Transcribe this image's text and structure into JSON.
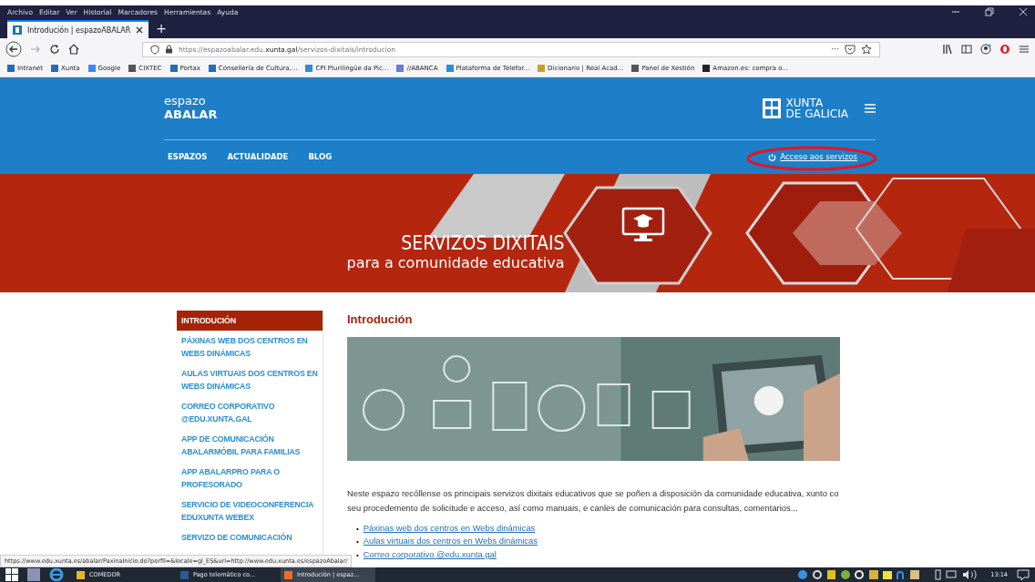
{
  "menu_bar": [
    "Archivo",
    "Editar",
    "Ver",
    "Historial",
    "Marcadores",
    "Herramientas",
    "Ayuda"
  ],
  "tabs": [
    {
      "label": "Introdución | espazoABALAR",
      "selected": true
    }
  ],
  "tab_new": "+",
  "address": {
    "url_start": "https://espazoabalar.edu.",
    "url_domain": "xunta.gal",
    "url_end": "/servizos-dixitais/introducion"
  },
  "address_more": "···",
  "bookmarks": [
    {
      "label": "Intranet",
      "kind": "xunta"
    },
    {
      "label": "Xunta",
      "kind": "xunta"
    },
    {
      "label": "Google",
      "kind": "google"
    },
    {
      "label": "CIXTEC",
      "kind": "globe"
    },
    {
      "label": "Portax",
      "kind": "xunta"
    },
    {
      "label": "Consellería de Cultura,...",
      "kind": "xunta"
    },
    {
      "label": "CPI Plurilingüe da Pic...",
      "kind": "blue"
    },
    {
      "label": "//ABANCA",
      "kind": "abanca"
    },
    {
      "label": "Plataforma de Telefor...",
      "kind": "blue"
    },
    {
      "label": "Dicionario | Real Acad...",
      "kind": "rae"
    },
    {
      "label": "Panel de Xestión",
      "kind": "globe"
    },
    {
      "label": "Amazon.es: compra o...",
      "kind": "amazon"
    }
  ],
  "site": {
    "logo_top": "espazo",
    "logo_bottom": "ABALAR",
    "xunta_top": "XUNTA",
    "xunta_bottom": "DE GALICIA",
    "nav": [
      "ESPAZOS",
      "ACTUALIDADE",
      "BLOG"
    ],
    "access": "Acceso aos servizos",
    "access_highlighted": true
  },
  "banner": {
    "title": "SERVIZOS DIXITAIS",
    "subtitle": "para a comunidade educativa"
  },
  "sidebar": [
    {
      "label": "INTRODUCIÓN",
      "selected": true
    },
    {
      "label": "PÁXINAS WEB DOS CENTROS EN WEBS DINÁMICAS",
      "selected": false
    },
    {
      "label": "AULAS VIRTUAIS DOS CENTROS EN WEBS DINÁMICAS",
      "selected": false
    },
    {
      "label": "CORREO CORPORATIVO @EDU.XUNTA.GAL",
      "selected": false
    },
    {
      "label": "APP DE COMUNICACIÓN ABALARMÓBIL PARA FAMILIAS",
      "selected": false
    },
    {
      "label": "APP ABALARPRO PARA O PROFESORADO",
      "selected": false
    },
    {
      "label": "SERVICIO DE VIDEOCONFERENCIA EDUXUNTA WEBEX",
      "selected": false
    },
    {
      "label": "SERVIZO DE COMUNICACIÓN",
      "selected": false
    }
  ],
  "article": {
    "title": "Introdución",
    "paragraph": "Neste espazo recóllense os principais servizos dixitais educativos que se poñen a disposición da comunidade educativa, xunto co seu procedemento de solicitude e acceso, así como manuais, e canles de comunicación para consultas, comentarios...",
    "link_bullet": "•",
    "links": [
      "Páxinas web dos centros en Webs dinámicas",
      "Aulas virtuais dos centros en Webs dinámicas",
      "Correo corporativo @edu.xunta.gal"
    ]
  },
  "status_url": "https://www.edu.xunta.es/abalar/PaxinaInicio.do?perfil=&locale=gl_ES&url=http://www.edu.xunta.es/espazoAbalar/",
  "taskbar": {
    "items": [
      {
        "label": "COMEDOR",
        "kind": "folder",
        "selected": false
      },
      {
        "label": "Pago telemático co...",
        "kind": "word",
        "selected": false
      },
      {
        "label": "Introdución | espaz...",
        "kind": "firefox",
        "selected": true
      }
    ],
    "time": "13:14"
  }
}
